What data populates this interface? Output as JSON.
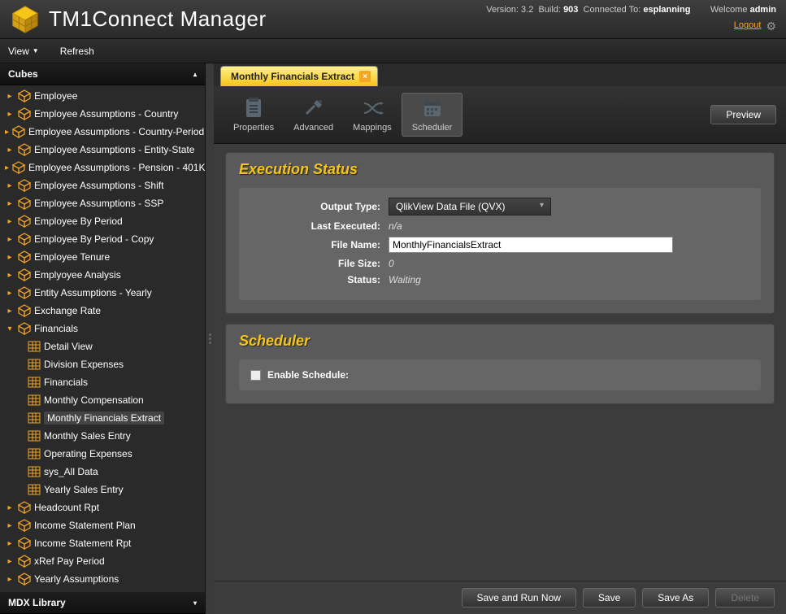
{
  "header": {
    "app_title": "TM1Connect Manager",
    "version_label": "Version:",
    "version": "3.2",
    "build_label": "Build:",
    "build": "903",
    "connected_label": "Connected To:",
    "connected": "esplanning",
    "welcome_label": "Welcome",
    "user": "admin",
    "logout": "Logout"
  },
  "menu": {
    "view": "View",
    "refresh": "Refresh"
  },
  "sidebar": {
    "cubes_header": "Cubes",
    "mdx_header": "MDX Library",
    "items": [
      {
        "label": "Employee",
        "type": "cube"
      },
      {
        "label": "Employee Assumptions - Country",
        "type": "cube"
      },
      {
        "label": "Employee Assumptions - Country-Period",
        "type": "cube"
      },
      {
        "label": "Employee Assumptions - Entity-State",
        "type": "cube"
      },
      {
        "label": "Employee Assumptions - Pension - 401K",
        "type": "cube"
      },
      {
        "label": "Employee Assumptions - Shift",
        "type": "cube"
      },
      {
        "label": "Employee Assumptions - SSP",
        "type": "cube"
      },
      {
        "label": "Employee By Period",
        "type": "cube"
      },
      {
        "label": "Employee By Period - Copy",
        "type": "cube"
      },
      {
        "label": "Employee Tenure",
        "type": "cube"
      },
      {
        "label": "Emplyoyee Analysis",
        "type": "cube"
      },
      {
        "label": "Entity Assumptions - Yearly",
        "type": "cube"
      },
      {
        "label": "Exchange Rate",
        "type": "cube"
      },
      {
        "label": "Financials",
        "type": "cube",
        "expanded": true,
        "children": [
          {
            "label": "Detail View"
          },
          {
            "label": "Division Expenses"
          },
          {
            "label": "Financials"
          },
          {
            "label": "Monthly Compensation"
          },
          {
            "label": "Monthly Financials Extract",
            "selected": true
          },
          {
            "label": "Monthly Sales Entry"
          },
          {
            "label": "Operating Expenses"
          },
          {
            "label": "sys_All Data"
          },
          {
            "label": "Yearly Sales Entry"
          }
        ]
      },
      {
        "label": "Headcount Rpt",
        "type": "cube"
      },
      {
        "label": "Income Statement Plan",
        "type": "cube"
      },
      {
        "label": "Income Statement Rpt",
        "type": "cube"
      },
      {
        "label": "xRef Pay Period",
        "type": "cube"
      },
      {
        "label": "Yearly Assumptions",
        "type": "cube"
      }
    ]
  },
  "tab": {
    "title": "Monthly Financials Extract"
  },
  "toolbar": {
    "properties": "Properties",
    "advanced": "Advanced",
    "mappings": "Mappings",
    "scheduler": "Scheduler",
    "preview": "Preview"
  },
  "exec": {
    "title": "Execution Status",
    "output_type_label": "Output Type:",
    "output_type_value": "QlikView Data File (QVX)",
    "last_exec_label": "Last Executed:",
    "last_exec_value": "n/a",
    "file_name_label": "File Name:",
    "file_name_value": "MonthlyFinancialsExtract",
    "file_size_label": "File Size:",
    "file_size_value": "0",
    "status_label": "Status:",
    "status_value": "Waiting"
  },
  "sched": {
    "title": "Scheduler",
    "enable_label": "Enable Schedule:"
  },
  "footer": {
    "save_run": "Save and Run Now",
    "save": "Save",
    "save_as": "Save As",
    "delete": "Delete"
  }
}
